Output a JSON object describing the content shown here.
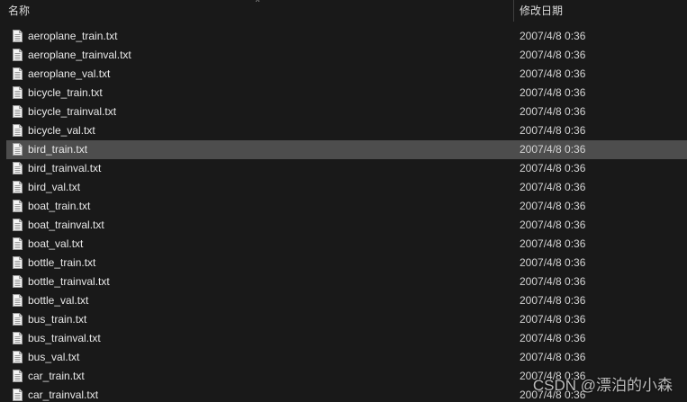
{
  "header": {
    "name_label": "名称",
    "date_label": "修改日期",
    "sort_arrow": "^"
  },
  "files": [
    {
      "name": "aeroplane_train.txt",
      "date": "2007/4/8 0:36"
    },
    {
      "name": "aeroplane_trainval.txt",
      "date": "2007/4/8 0:36"
    },
    {
      "name": "aeroplane_val.txt",
      "date": "2007/4/8 0:36"
    },
    {
      "name": "bicycle_train.txt",
      "date": "2007/4/8 0:36"
    },
    {
      "name": "bicycle_trainval.txt",
      "date": "2007/4/8 0:36"
    },
    {
      "name": "bicycle_val.txt",
      "date": "2007/4/8 0:36"
    },
    {
      "name": "bird_train.txt",
      "date": "2007/4/8 0:36"
    },
    {
      "name": "bird_trainval.txt",
      "date": "2007/4/8 0:36"
    },
    {
      "name": "bird_val.txt",
      "date": "2007/4/8 0:36"
    },
    {
      "name": "boat_train.txt",
      "date": "2007/4/8 0:36"
    },
    {
      "name": "boat_trainval.txt",
      "date": "2007/4/8 0:36"
    },
    {
      "name": "boat_val.txt",
      "date": "2007/4/8 0:36"
    },
    {
      "name": "bottle_train.txt",
      "date": "2007/4/8 0:36"
    },
    {
      "name": "bottle_trainval.txt",
      "date": "2007/4/8 0:36"
    },
    {
      "name": "bottle_val.txt",
      "date": "2007/4/8 0:36"
    },
    {
      "name": "bus_train.txt",
      "date": "2007/4/8 0:36"
    },
    {
      "name": "bus_trainval.txt",
      "date": "2007/4/8 0:36"
    },
    {
      "name": "bus_val.txt",
      "date": "2007/4/8 0:36"
    },
    {
      "name": "car_train.txt",
      "date": "2007/4/8 0:36"
    },
    {
      "name": "car_trainval.txt",
      "date": "2007/4/8 0:36"
    }
  ],
  "selected_file": "bird_train.txt",
  "watermark": "CSDN @漂泊的小森",
  "colors": {
    "background": "#191919",
    "selected_row": "#4d4d4d",
    "text": "#e8e8e8"
  },
  "icons": {
    "file": "text-file-icon"
  }
}
